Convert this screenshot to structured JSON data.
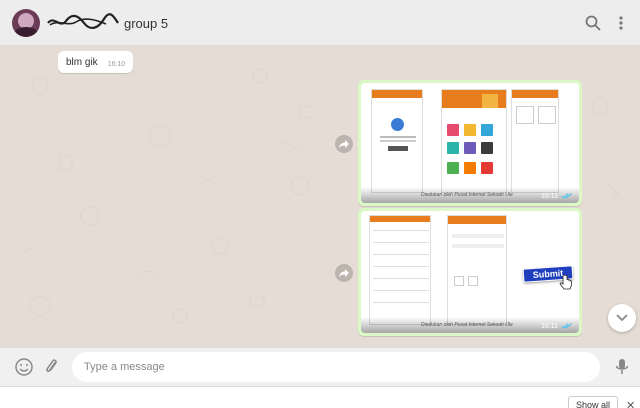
{
  "header": {
    "title_suffix": "group 5"
  },
  "messages": [
    {
      "text": "blm gik",
      "time": "16:10"
    }
  ],
  "images": [
    {
      "time": "16:11",
      "caption": "Diedukan oleh Pusat Internet Sekoah Ule"
    },
    {
      "time": "16:11",
      "caption": "Diedukan oleh Pusat Internet Sekoah Ule",
      "submit_label": "Submit"
    }
  ],
  "composer": {
    "placeholder": "Type a message"
  },
  "downloads": {
    "show_all_label": "Show all",
    "close_label": "✕"
  }
}
